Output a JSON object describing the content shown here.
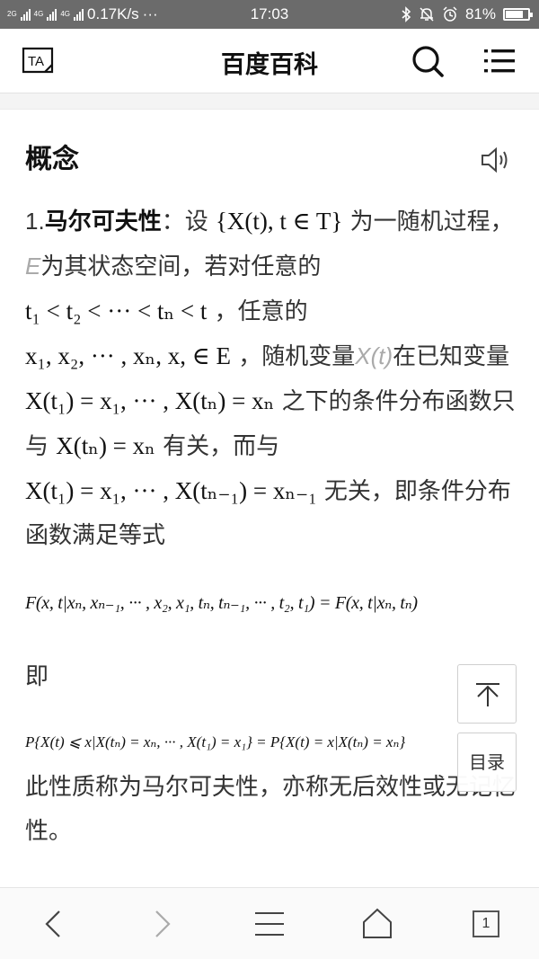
{
  "status_bar": {
    "network_labels": [
      "2G",
      "4G",
      "4G"
    ],
    "speed": "0.17K/s",
    "dots": "···",
    "time": "17:03",
    "battery_level": 0.81,
    "battery_text": "81%"
  },
  "header": {
    "ta_label": "TA",
    "title": "百度百科"
  },
  "section": {
    "title": "概念",
    "p_num": "1.",
    "p_term": "马尔可夫性",
    "p_a": "：设 ",
    "p_b": "{X(t), t ∈ T}",
    "p_c": " 为一随机过程，",
    "p_d": "E",
    "p_e": "为其状态空间，若对任意的",
    "p_f": "t₁ < t₂ < ··· < tₙ < t",
    "p_g": " ，任意的",
    "p_h": "x₁, x₂, ··· , xₙ, x, ∈ E",
    "p_i": " ，随机变量",
    "p_j": "X(t)",
    "p_k": "在已知变量 ",
    "p_l": "X(t₁) = x₁, ··· , X(tₙ) = xₙ",
    "p_m": " 之下的条件分布函数只与 ",
    "p_n": "X(tₙ) = xₙ",
    "p_o": " 有关，而与",
    "p_p": "X(t₁) = x₁, ··· , X(tₙ₋₁) = xₙ₋₁",
    "p_q": " 无关，即条件分布函数满足等式",
    "formula1": "F(x, t|xₙ, xₙ₋₁, ··· , x₂, x₁, tₙ, tₙ₋₁, ··· , t₂, t₁) = F(x, t|xₙ, tₙ)",
    "ji": "即",
    "formula2": "P{X(t) ⩽ x|X(tₙ) = xₙ, ··· , X(t₁) = x₁} = P{X(t) = x|X(tₙ) = xₙ}",
    "closing": "此性质称为马尔可夫性，亦称无后效性或无记忆性。"
  },
  "float_buttons": {
    "toc_label": "目录"
  },
  "bottom_nav": {
    "tab_count": "1"
  }
}
